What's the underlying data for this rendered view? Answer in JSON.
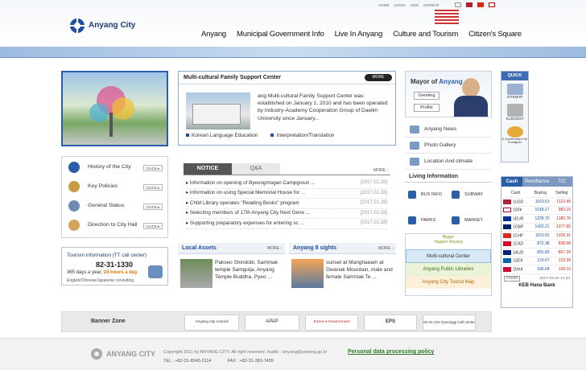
{
  "header": {
    "logo": "Anyang City",
    "util": [
      "HOME",
      "LOGIN",
      "JOIN",
      "SITEMAP"
    ],
    "nav": [
      "Anyang",
      "Municipal Government Info",
      "Live In Anyang",
      "Culture and Tourism",
      "Citizen's Square"
    ]
  },
  "feature": {
    "title": "Multi-cultural Family Support Center",
    "more": "MORE",
    "body": "ang Multi-cultural Family Support Center was established on January 1, 2010 and has been operated by Industry-Academy Cooperation Group of Daelim University since January...",
    "links": [
      "Korean Language Education",
      "Interpretation/Translation"
    ]
  },
  "mayor": {
    "title_prefix": "Mayor of",
    "title_name": "Anyang",
    "buttons": [
      "Greeting",
      "Profile"
    ],
    "links": [
      "Anyang News",
      "Photo Gallery",
      "Location And climate"
    ]
  },
  "quick": {
    "title": "QUICK",
    "items": [
      "SITEMAP",
      "SUGGEST",
      "E-Government for Foreigner"
    ]
  },
  "leftmenu": {
    "items": [
      "History of the City",
      "Key Policies",
      "General Status",
      "Direction to City Hall"
    ],
    "click": "CLICK"
  },
  "tourism": {
    "title": "Tourism information (TT call center)",
    "phone": "82-31-1330",
    "line1_prefix": "365 days a year, ",
    "line1_emph": "24 hours a day",
    "line2": "English/Chinese/Japanese consulting"
  },
  "notice": {
    "tabs": [
      "NOTICE",
      "Q&A"
    ],
    "more": "MORE",
    "items": [
      {
        "t": "Information on opening of Byeongmogan Campgroun ...",
        "d": "[2017.02.28]"
      },
      {
        "t": "Information on using Special Memorial House for ...",
        "d": "[2017.02.28]"
      },
      {
        "t": "Child Library operates \"Reading Books\" program",
        "d": "[2017.02.28]"
      },
      {
        "t": "Selecting members of 17th Anyang City Next Gene ...",
        "d": "[2017.02.28]"
      },
      {
        "t": "Supporting preparatory expenses for entering sc ...",
        "d": "[2017.02.28]"
      }
    ]
  },
  "living": {
    "title": "Living Information",
    "items": [
      "BUS INFO",
      "SUBWAY",
      "PARKS",
      "MARKET"
    ]
  },
  "promo": {
    "title1": "Bigger",
    "title2": "Happier",
    "title3": "Anyang",
    "links": [
      "Multi-cultural Center",
      "Anyang Public Libraries",
      "Anyang City Tourist Map"
    ]
  },
  "local": {
    "title": "Local Assets",
    "more": "MORE",
    "text": "Pakseo Shindobi, Sammak temple Samguija, Anyang Temple Buddha, Pyeo ..."
  },
  "sights": {
    "title": "Anyang 8 sights",
    "more": "MORE",
    "text": "sunset at Manghaeam at Gwanak Mountain, male and female Sammak Te ..."
  },
  "fx": {
    "tabs": [
      "Cash",
      "Remittance",
      "T/C"
    ],
    "headers": [
      "Cash",
      "Buying",
      "Selling"
    ],
    "rows": [
      {
        "c": "1USD",
        "b": "1163.51",
        "s": "1123.49",
        "flag": "#b22234"
      },
      {
        "c": "100¥",
        "b": "1018.17",
        "s": "983.15",
        "flag": "#bc002d"
      },
      {
        "c": "1EUR",
        "b": "1228.70",
        "s": "1180.76",
        "flag": "#003399"
      },
      {
        "c": "1GBP",
        "b": "1433.21",
        "s": "1377.85",
        "flag": "#012169"
      },
      {
        "c": "1CHF",
        "b": "1153.91",
        "s": "1109.31",
        "flag": "#d52b1e"
      },
      {
        "c": "1CAD",
        "b": "872.38",
        "s": "838.68",
        "flag": "#d80621"
      },
      {
        "c": "1AUD",
        "b": "891.83",
        "s": "857.39",
        "flag": "#00247d"
      },
      {
        "c": "1SEK",
        "b": "129.57",
        "s": "123.39",
        "flag": "#006aa7"
      },
      {
        "c": "1DKK",
        "b": "166.04",
        "s": "158.10",
        "flag": "#c60c30"
      }
    ],
    "home": "HOME",
    "stamp": "2017-03-02 17:34",
    "bank": "KEB Hana Bank"
  },
  "banners": {
    "title": "Banner Zone",
    "items": [
      "Anyang city council",
      "APAP",
      "Korea e-Government",
      "EPS",
      "82-31-120 Gyeonggi Call center"
    ]
  },
  "footer": {
    "logo": "ANYANG CITY",
    "copy": "Copyright 2011 by ANYANG CITY. All right reserved. mailto : anyang@anyang.go.kr",
    "privacy": "Personal data processing policy",
    "tel": "TEL : +82-31-8045-2114",
    "fax": "FAX : +82-31-383-7455"
  },
  "colors": {
    "brand": "#1f4fa0",
    "accent": "#2b5ea8",
    "red": "#c52424"
  }
}
